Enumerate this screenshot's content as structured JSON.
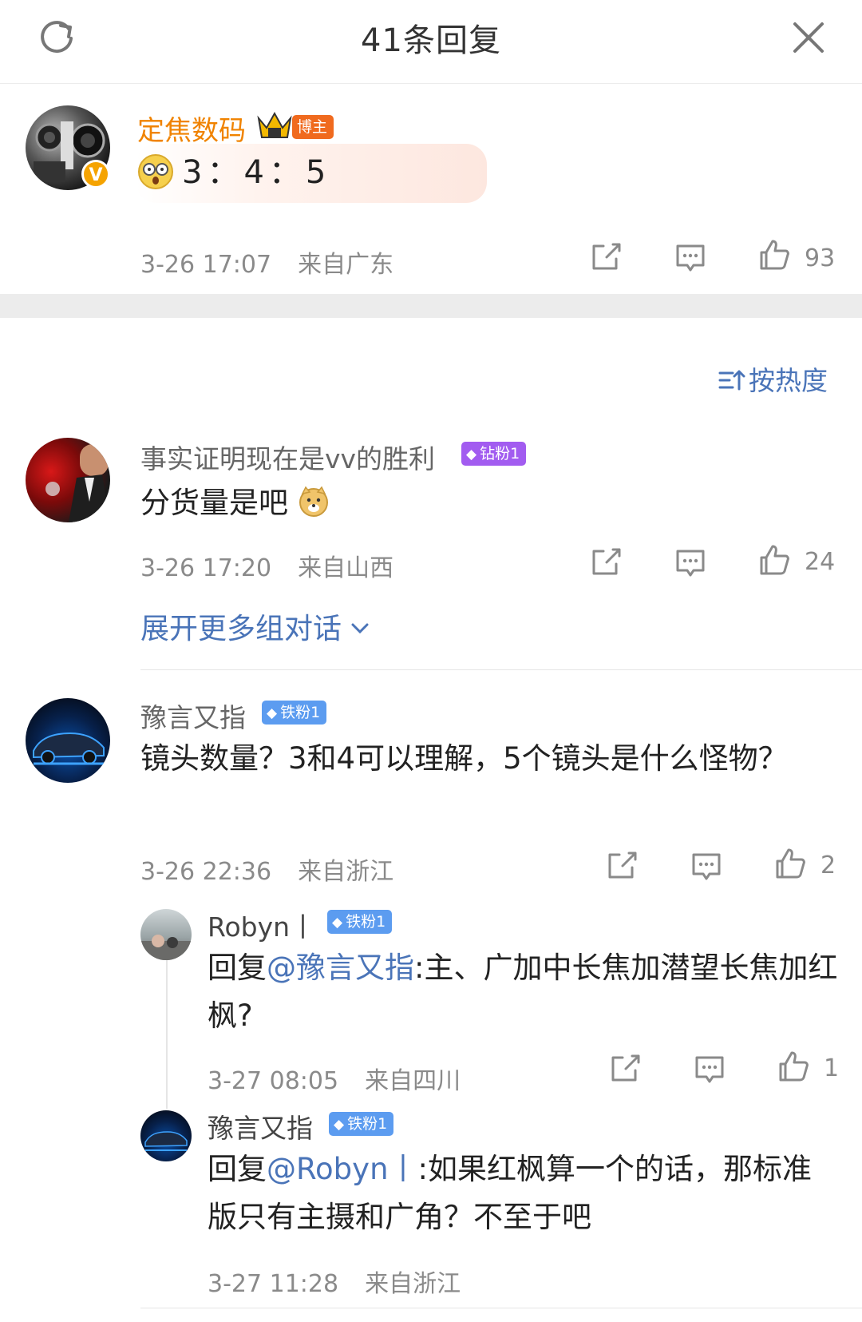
{
  "header": {
    "title": "41条回复",
    "refresh_icon": "refresh-icon",
    "close_icon": "close-icon"
  },
  "root_comment": {
    "author": "定焦数码",
    "badge": "博主",
    "content": "3：4：5",
    "time": "3-26 17:07",
    "location": "来自广东",
    "likes": "93"
  },
  "sort": {
    "label": "按热度"
  },
  "replies": [
    {
      "author": "事实证明现在是vv的胜利",
      "badge": "钻粉1",
      "content": "分货量是吧",
      "time": "3-26 17:20",
      "location": "来自山西",
      "likes": "24",
      "expand_label": "展开更多组对话"
    },
    {
      "author": "豫言又指",
      "badge": "铁粉1",
      "content": "镜头数量？3和4可以理解，5个镜头是什么怪物？",
      "time": "3-26 22:36",
      "location": "来自浙江",
      "likes": "2",
      "sub_replies": [
        {
          "author": "Robyn丨",
          "badge": "铁粉1",
          "prefix": "回复",
          "mention": "@豫言又指",
          "content": ":主、广加中长焦加潜望长焦加红枫?",
          "time": "3-27 08:05",
          "location": "来自四川",
          "likes": "1"
        },
        {
          "author": "豫言又指",
          "badge": "铁粉1",
          "prefix": "回复",
          "mention": "@Robyn丨",
          "content": ":如果红枫算一个的话，那标准版只有主摄和广角？不至于吧",
          "time": "3-27 11:28",
          "location": "来自浙江"
        }
      ]
    }
  ],
  "colors": {
    "accent": "#4a74b8",
    "author_orange": "#f08300",
    "meta_gray": "#8a8a8a",
    "diamond_badge": "#a25cf0",
    "iron_badge": "#5c9cf0"
  }
}
